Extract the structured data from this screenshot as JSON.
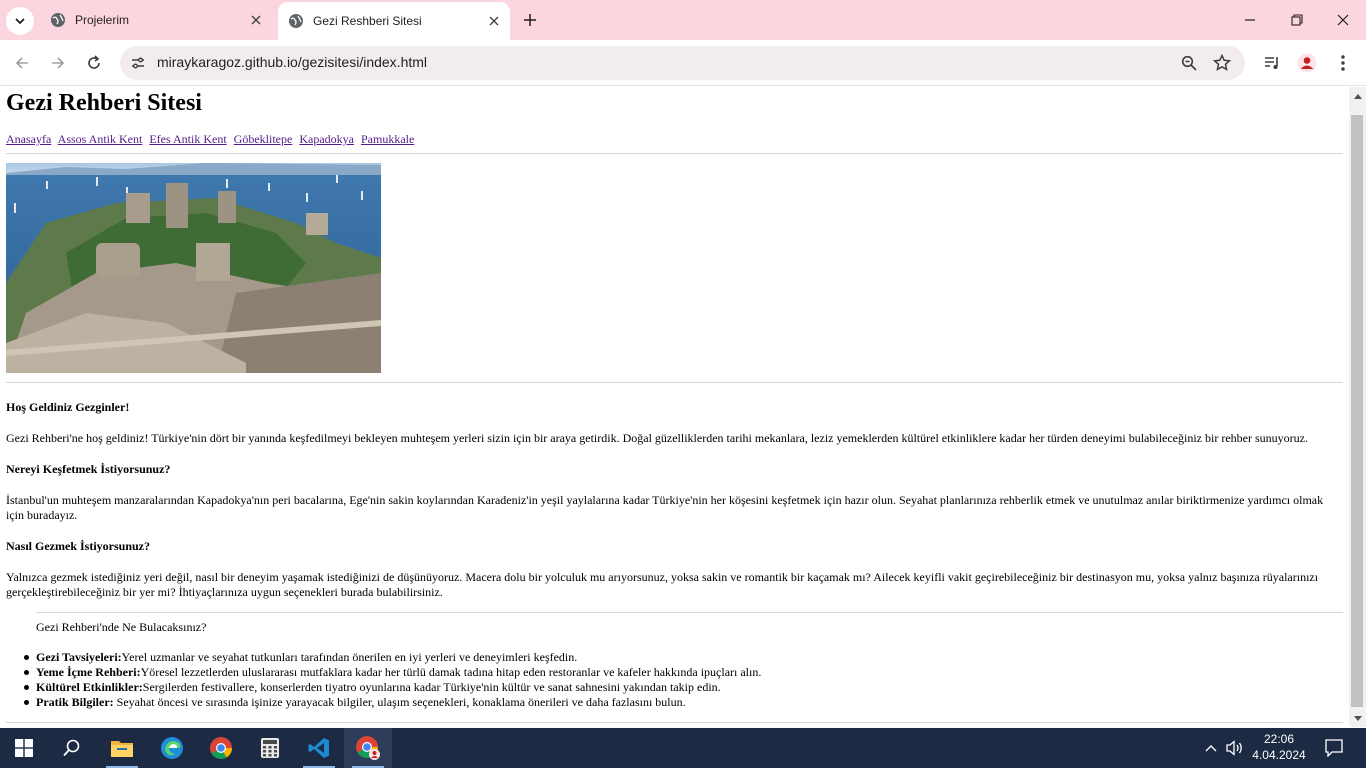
{
  "browser": {
    "tabs": [
      {
        "title": "Projelerim",
        "active": false
      },
      {
        "title": "Gezi Reshberi Sitesi",
        "active": true
      }
    ],
    "url": "miraykaragoz.github.io/gezisitesi/index.html"
  },
  "page": {
    "heading": "Gezi Rehberi Sitesi",
    "nav": [
      "Anasayfa",
      "Assos Antik Kent",
      "Efes Antik Kent",
      "Göbeklitepe",
      "Kapadokya",
      "Pamukkale"
    ],
    "welcome_title": "Hoş Geldiniz Gezginler!",
    "welcome_text": "Gezi Rehberi'ne hoş geldiniz! Türkiye'nin dört bir yanında keşfedilmeyi bekleyen muhteşem yerleri sizin için bir araya getirdik. Doğal güzelliklerden tarihi mekanlara, leziz yemeklerden kültürel etkinliklere kadar her türden deneyimi bulabileceğiniz bir rehber sunuyoruz.",
    "explore_title": "Nereyi Keşfetmek İstiyorsunuz?",
    "explore_text": "İstanbul'un muhteşem manzaralarından Kapadokya'nın peri bacalarına, Ege'nin sakin koylarından Karadeniz'in yeşil yaylalarına kadar Türkiye'nin her köşesini keşfetmek için hazır olun. Seyahat planlarınıza rehberlik etmek ve unutulmaz anılar biriktirmenize yardımcı olmak için buradayız.",
    "how_title": "Nasıl Gezmek İstiyorsunuz?",
    "how_text": "Yalnızca gezmek istediğiniz yeri değil, nasıl bir deneyim yaşamak istediğinizi de düşünüyoruz. Macera dolu bir yolculuk mu arıyorsunuz, yoksa sakin ve romantik bir kaçamak mı? Ailecek keyifli vakit geçirebileceğiniz bir destinasyon mu, yoksa yalnız başınıza rüyalarınızı gerçekleştirebileceğiniz bir yer mi? İhtiyaçlarınıza uygun seçenekleri burada bulabilirsiniz.",
    "find_title": "Gezi Rehberi'nde Ne Bulacaksınız?",
    "features": [
      {
        "label": "Gezi Tavsiyeleri:",
        "text": "Yerel uzmanlar ve seyahat tutkunları tarafından önerilen en iyi yerleri ve deneyimleri keşfedin."
      },
      {
        "label": "Yeme İçme Rehberi:",
        "text": "Yöresel lezzetlerden uluslararası mutfaklara kadar her türlü damak tadına hitap eden restoranlar ve kafeler hakkında ipuçları alın."
      },
      {
        "label": "Kültürel Etkinlikler:",
        "text": "Sergilerden festivallere, konserlerden tiyatro oyunlarına kadar Türkiye'nin kültür ve sanat sahnesini yakından takip edin."
      },
      {
        "label": "Pratik Bilgiler:",
        "text": " Seyahat öncesi ve sırasında işinize yarayacak bilgiler, ulaşım seçenekleri, konaklama önerileri ve daha fazlasını bulun."
      }
    ]
  },
  "taskbar": {
    "time": "22:06",
    "date": "4.04.2024"
  },
  "colors": {
    "tabstrip": "#fcd6de",
    "omnibox": "#f3ecee",
    "visited_link": "#551a8b",
    "taskbar": "#1c2a44"
  },
  "icons": [
    "tab-search-icon",
    "globe-icon",
    "close-icon",
    "plus-icon",
    "minimize-icon",
    "restore-icon",
    "back-icon",
    "forward-icon",
    "reload-icon",
    "site-info-icon",
    "zoom-icon",
    "star-icon",
    "media-icon",
    "profile-icon",
    "menu-icon",
    "windows-icon",
    "search-icon",
    "file-explorer-icon",
    "edge-icon",
    "chrome-icon",
    "calculator-icon",
    "vscode-icon",
    "chrome-profile-icon",
    "chevron-up-icon",
    "speaker-icon",
    "notification-icon"
  ]
}
